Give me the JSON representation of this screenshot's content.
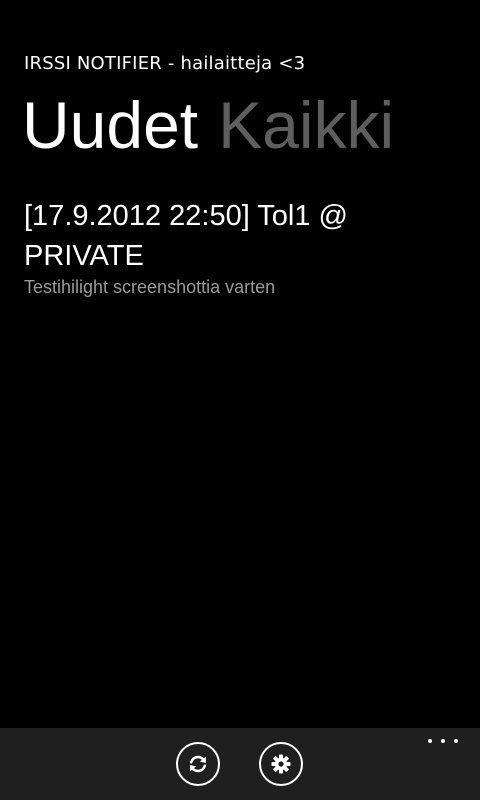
{
  "header": {
    "app_title": "IRSSI NOTIFIER - hailaitteja <3"
  },
  "pivot": {
    "tabs": [
      {
        "label": "Uudet",
        "active": true
      },
      {
        "label": "Kaikki",
        "active": false
      }
    ]
  },
  "notifications": [
    {
      "title": "[17.9.2012 22:50] Tol1 @ PRIVATE",
      "message": "Testihilight screenshottia varten"
    }
  ],
  "app_bar": {
    "buttons": [
      {
        "icon": "refresh-icon"
      },
      {
        "icon": "gear-icon"
      }
    ],
    "more_icon": "ellipsis-icon",
    "background": "#1f1f1f"
  },
  "colors": {
    "background": "#000000",
    "foreground": "#ffffff",
    "inactive_pivot": "#5e5e5e",
    "subtle_text": "#9a9a9a"
  }
}
